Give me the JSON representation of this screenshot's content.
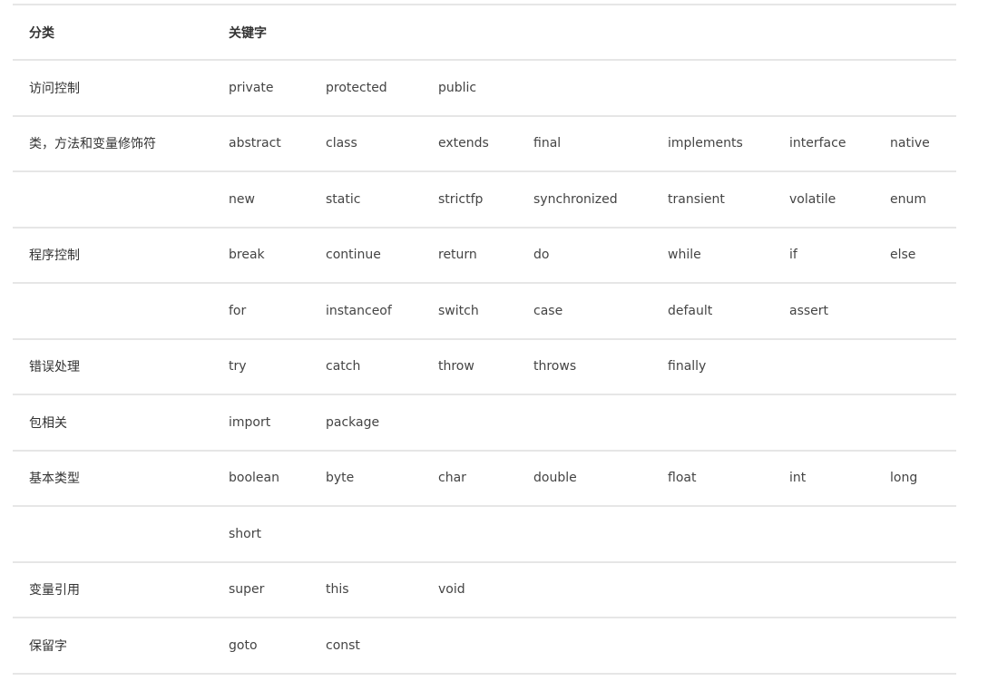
{
  "table": {
    "headers": [
      "分类",
      "关键字"
    ],
    "rows": [
      {
        "category": "访问控制",
        "keywords": [
          "private",
          "protected",
          "public",
          "",
          "",
          "",
          ""
        ]
      },
      {
        "category": "类，方法和变量修饰符",
        "keywords": [
          "abstract",
          "class",
          "extends",
          "final",
          "implements",
          "interface",
          "native"
        ]
      },
      {
        "category": "",
        "keywords": [
          "new",
          "static",
          "strictfp",
          "synchronized",
          "transient",
          "volatile",
          "enum"
        ]
      },
      {
        "category": "程序控制",
        "keywords": [
          "break",
          "continue",
          "return",
          "do",
          "while",
          "if",
          "else"
        ]
      },
      {
        "category": "",
        "keywords": [
          "for",
          "instanceof",
          "switch",
          "case",
          "default",
          "assert",
          ""
        ]
      },
      {
        "category": "错误处理",
        "keywords": [
          "try",
          "catch",
          "throw",
          "throws",
          "finally",
          "",
          ""
        ]
      },
      {
        "category": "包相关",
        "keywords": [
          "import",
          "package",
          "",
          "",
          "",
          "",
          ""
        ]
      },
      {
        "category": "基本类型",
        "keywords": [
          "boolean",
          "byte",
          "char",
          "double",
          "float",
          "int",
          "long"
        ]
      },
      {
        "category": "",
        "keywords": [
          "short",
          "",
          "",
          "",
          "",
          "",
          ""
        ]
      },
      {
        "category": "变量引用",
        "keywords": [
          "super",
          "this",
          "void",
          "",
          "",
          "",
          ""
        ]
      },
      {
        "category": "保留字",
        "keywords": [
          "goto",
          "const",
          "",
          "",
          "",
          "",
          ""
        ]
      }
    ]
  }
}
